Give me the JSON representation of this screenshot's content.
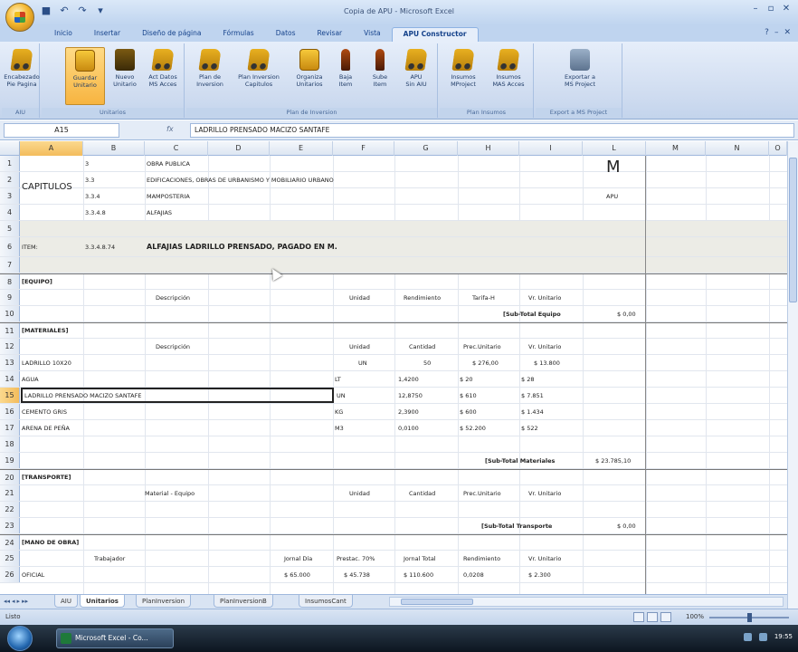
{
  "window": {
    "title": "Copia de APU - Microsoft Excel",
    "controls": [
      "–",
      "▫",
      "✕"
    ]
  },
  "qat_icons": [
    "save-icon",
    "undo-icon",
    "redo-icon",
    "qat-dropdown-icon"
  ],
  "tabs": [
    {
      "label": "Inicio"
    },
    {
      "label": "Insertar"
    },
    {
      "label": "Diseño de página"
    },
    {
      "label": "Fórmulas"
    },
    {
      "label": "Datos"
    },
    {
      "label": "Revisar"
    },
    {
      "label": "Vista"
    },
    {
      "label": "APU Constructor",
      "active": true
    }
  ],
  "ribbon": {
    "groups": [
      {
        "label": "AIU",
        "buttons": [
          {
            "label": "Encabezado\nPie Pagina",
            "icon": "truck"
          }
        ]
      },
      {
        "label": "Unitarios",
        "buttons": [
          {
            "label": "Guardar\nUnitario",
            "icon": "yellow",
            "selected": true
          },
          {
            "label": "Nuevo\nUnitario",
            "icon": "dark"
          },
          {
            "label": "Act Datos\nMS Acces",
            "icon": "truck"
          }
        ]
      },
      {
        "label": "Plan de Inversion",
        "buttons": [
          {
            "label": "Plan de\nInversion",
            "icon": "truck"
          },
          {
            "label": "Plan Inversion\nCapitulos",
            "icon": "truck"
          },
          {
            "label": "Organiza\nUnitarios",
            "icon": "yellow"
          },
          {
            "label": "Baja\nItem",
            "icon": "tall"
          },
          {
            "label": "Sube\nItem",
            "icon": "tall"
          },
          {
            "label": "APU\nSin AIU",
            "icon": "truck"
          }
        ]
      },
      {
        "label": "Plan Insumos",
        "buttons": [
          {
            "label": "Insumos\nMProject",
            "icon": "truck"
          },
          {
            "label": "Insumos\nMAS Acces",
            "icon": "truck"
          }
        ]
      },
      {
        "label": "Export a MS Project",
        "buttons": [
          {
            "label": "Exportar a\nMS Project",
            "icon": "gray"
          }
        ]
      }
    ]
  },
  "formula_bar": {
    "name_box": "A15",
    "fx": "fx",
    "formula": "LADRILLO PRENSADO MACIZO SANTAFE"
  },
  "columns": [
    "A",
    "B",
    "C",
    "D",
    "E",
    "F",
    "G",
    "H",
    "I",
    "L",
    "M",
    "N",
    "O"
  ],
  "sheet": {
    "r1": {
      "num": "1",
      "b": "3",
      "c": "OBRA PUBLICA",
      "m": "M"
    },
    "r2": {
      "num": "2",
      "a": "CAPITULOS",
      "b": "3.3",
      "c": "EDIFICACIONES, OBRAS DE URBANISMO Y MOBILIARIO URBANO"
    },
    "r3": {
      "num": "3",
      "b": "3.3.4",
      "c": "MAMPOSTERIA",
      "m": "APU"
    },
    "r4": {
      "num": "4",
      "b": "3.3.4.8",
      "c": "ALFAJIAS"
    },
    "r5": {
      "num": "5"
    },
    "r6": {
      "num": "6",
      "a": "ITEM:",
      "b": "3.3.4.8.74",
      "c": "ALFAJIAS LADRILLO PRENSADO, PAGADO EN M."
    },
    "r7": {
      "num": "7"
    },
    "r8": {
      "num": "8",
      "a": "[EQUIPO]"
    },
    "r9": {
      "num": "9",
      "desc": "Descripción",
      "f": "Unidad",
      "g": "Rendimiento",
      "h": "Tarifa-H",
      "i": "Vr. Unitario"
    },
    "r10": {
      "num": "10",
      "label": "[Sub-Total Equipo",
      "val": "$ 0,00"
    },
    "r11": {
      "num": "11",
      "a": "[MATERIALES]"
    },
    "r12": {
      "num": "12",
      "desc": "Descripción",
      "f": "Unidad",
      "g": "Cantidad",
      "h": "Prec.Unitario",
      "i": "Vr. Unitario"
    },
    "r13": {
      "num": "13",
      "a": "LADRILLO 10X20",
      "f": "UN",
      "g": "50",
      "h": "$ 276,00",
      "i": "$ 13.800"
    },
    "r14": {
      "num": "14",
      "a": "AGUA",
      "f": "LT",
      "g": "1,4200",
      "h": "$ 20",
      "i": "$ 28"
    },
    "r15": {
      "num": "15",
      "a": "LADRILLO PRENSADO MACIZO SANTAFE",
      "f": "UN",
      "g": "12,8750",
      "h": "$ 610",
      "i": "$ 7.851"
    },
    "r16": {
      "num": "16",
      "a": "CEMENTO GRIS",
      "f": "KG",
      "g": "2,3900",
      "h": "$ 600",
      "i": "$ 1.434"
    },
    "r17": {
      "num": "17",
      "a": "ARENA DE PEÑA",
      "f": "M3",
      "g": "0,0100",
      "h": "$ 52.200",
      "i": "$ 522"
    },
    "r18": {
      "num": "18"
    },
    "r19": {
      "num": "19",
      "label": "[Sub-Total Materiales",
      "val": "$ 23.785,10"
    },
    "r20": {
      "num": "20",
      "a": "[TRANSPORTE]"
    },
    "r21": {
      "num": "21",
      "desc": "Material - Equipo",
      "f": "Unidad",
      "g": "Cantidad",
      "h": "Prec.Unitario",
      "i": "Vr. Unitario"
    },
    "r22": {
      "num": "22"
    },
    "r23": {
      "num": "23",
      "label": "[Sub-Total Transporte",
      "val": "$ 0,00"
    },
    "r24": {
      "num": "24",
      "a": "[MANO DE OBRA]"
    },
    "r25": {
      "num": "25",
      "desc": "Trabajador",
      "e": "Jornal Día",
      "f": "Prestac. 70%",
      "g": "Jornal Total",
      "h": "Rendimiento",
      "i": "Vr. Unitario"
    },
    "r26": {
      "num": "26",
      "a": "OFICIAL",
      "e": "$ 65.000",
      "f": "$ 45.738",
      "g": "$ 110.600",
      "h": "0,0208",
      "i": "$ 2.300"
    }
  },
  "sheet_tabs": [
    {
      "label": "AIU"
    },
    {
      "label": "Unitarios",
      "active": true
    },
    {
      "label": "PlanInversion"
    },
    {
      "label": "PlanInversionB"
    },
    {
      "label": "InsumosCant"
    }
  ],
  "status": {
    "text": "Listo",
    "zoom": "100%"
  },
  "taskbar": {
    "task": "Microsoft Excel - Co...",
    "time": "19:55"
  }
}
